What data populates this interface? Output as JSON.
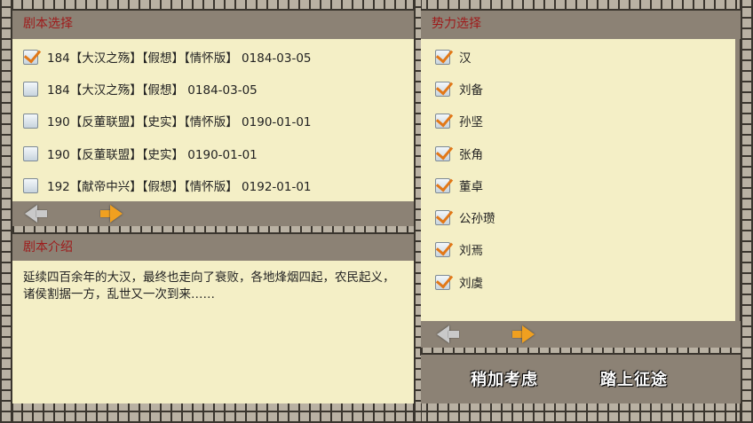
{
  "scenario": {
    "header": "剧本选择",
    "items": [
      {
        "text": "184【大汉之殇】【假想】【情怀版】 0184-03-05",
        "checked": true
      },
      {
        "text": "184【大汉之殇】【假想】 0184-03-05",
        "checked": false
      },
      {
        "text": "190【反董联盟】【史实】【情怀版】 0190-01-01",
        "checked": false
      },
      {
        "text": "190【反董联盟】【史实】 0190-01-01",
        "checked": false
      },
      {
        "text": "192【献帝中兴】【假想】【情怀版】 0192-01-01",
        "checked": false
      }
    ]
  },
  "intro": {
    "header": "剧本介绍",
    "text": "延续四百余年的大汉，最终也走向了衰败，各地烽烟四起，农民起义，诸侯割据一方，乱世又一次到来……"
  },
  "faction": {
    "header": "势力选择",
    "items": [
      {
        "text": "汉",
        "checked": true
      },
      {
        "text": "刘备",
        "checked": true
      },
      {
        "text": "孙坚",
        "checked": true
      },
      {
        "text": "张角",
        "checked": true
      },
      {
        "text": "董卓",
        "checked": true
      },
      {
        "text": "公孙瓒",
        "checked": true
      },
      {
        "text": "刘焉",
        "checked": true
      },
      {
        "text": "刘虞",
        "checked": true
      }
    ]
  },
  "buttons": {
    "consider": "稍加考虑",
    "start": "踏上征途"
  },
  "colors": {
    "header_text": "#9e1b1b",
    "panel_bg": "#f4efc6",
    "check_mark": "#e27818"
  }
}
